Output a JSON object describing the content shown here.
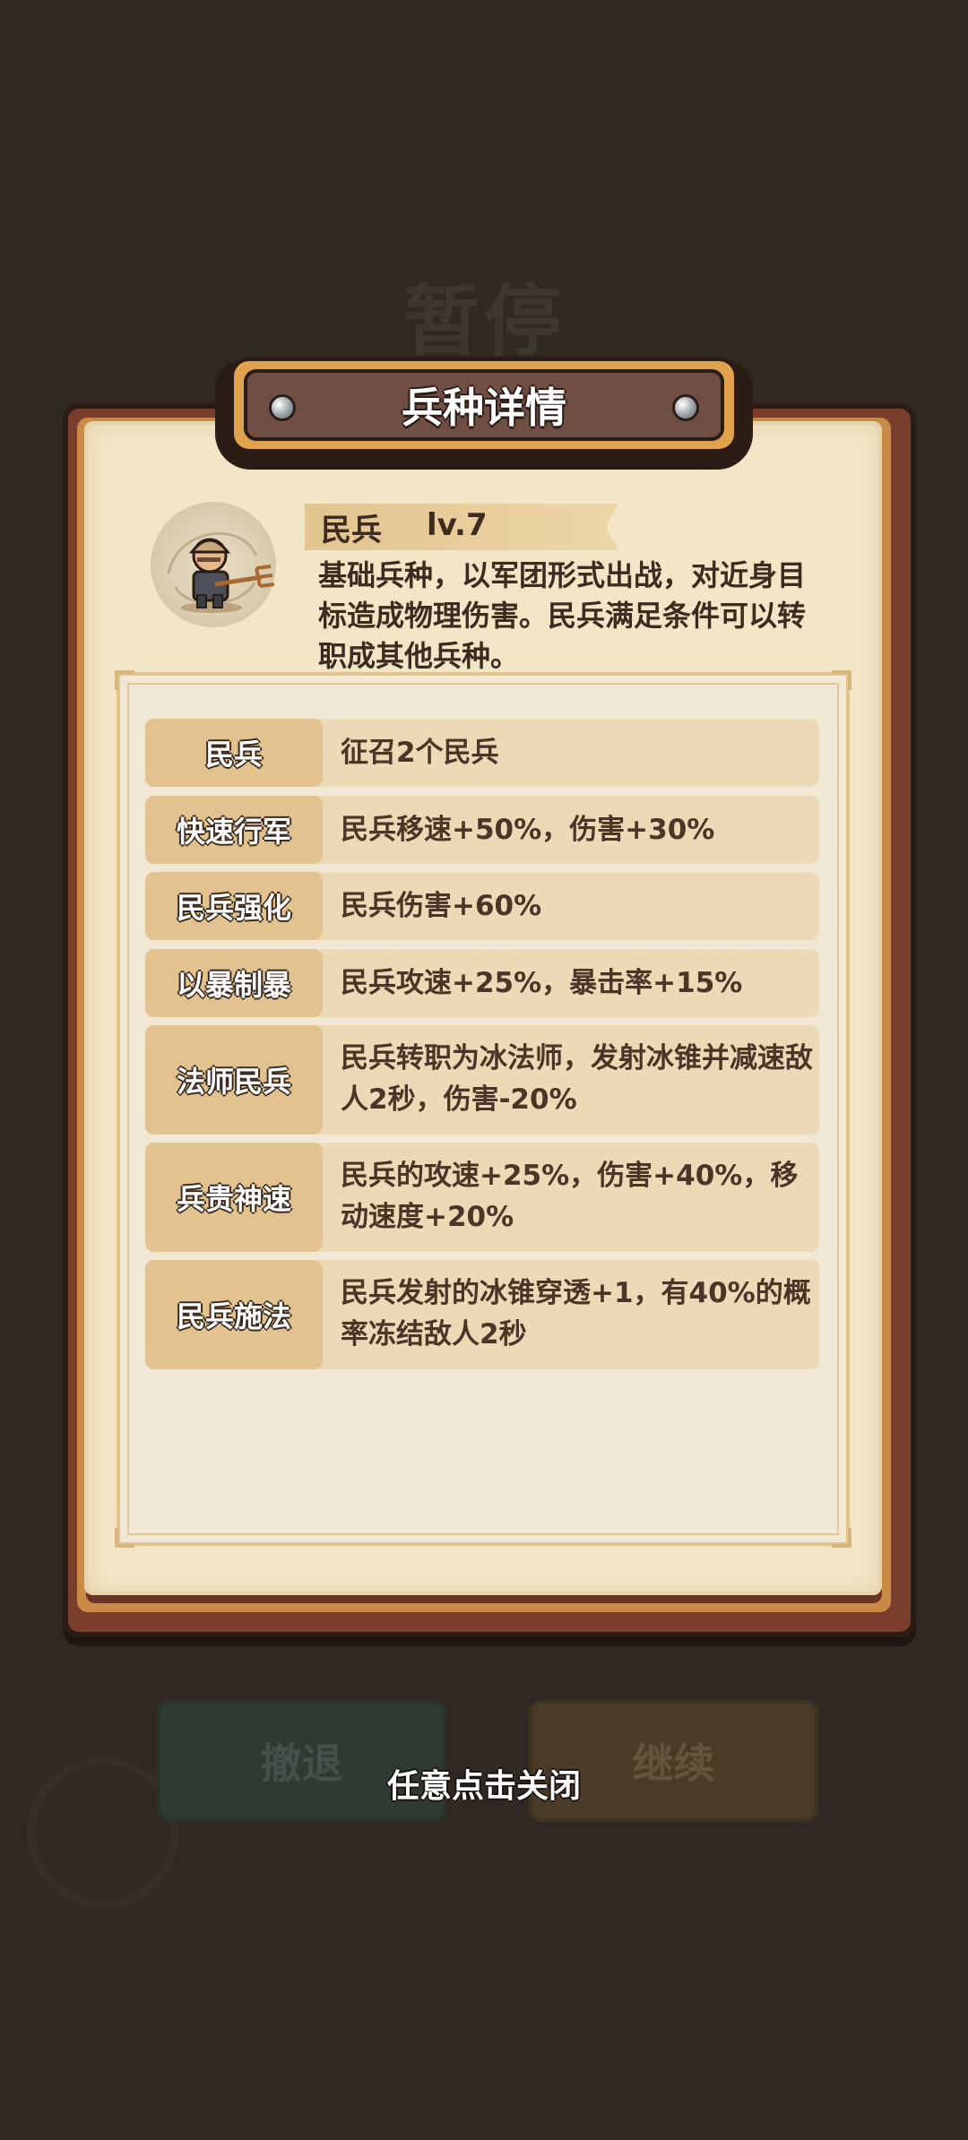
{
  "background": {
    "paused_title": "暂停",
    "retreat_label": "撤退",
    "continue_label": "继续"
  },
  "panel": {
    "title": "兵种详情"
  },
  "unit": {
    "name": "民兵",
    "level": "lv.7",
    "description": "基础兵种，以军团形式出战，对近身目标造成物理伤害。民兵满足条件可以转职成其他兵种。"
  },
  "talents": [
    {
      "name": "民兵",
      "desc": "征召2个民兵"
    },
    {
      "name": "快速行军",
      "desc": "民兵移速+50%，伤害+30%"
    },
    {
      "name": "民兵强化",
      "desc": "民兵伤害+60%"
    },
    {
      "name": "以暴制暴",
      "desc": "民兵攻速+25%，暴击率+15%"
    },
    {
      "name": "法师民兵",
      "desc": "民兵转职为冰法师，发射冰锥并减速敌人2秒，伤害-20%"
    },
    {
      "name": "兵贵神速",
      "desc": "民兵的攻速+25%，伤害+40%，移动速度+20%"
    },
    {
      "name": "民兵施法",
      "desc": "民兵发射的冰锥穿透+1，有40%的概率冻结敌人2秒"
    }
  ],
  "close_hint": "任意点击关闭",
  "colors": {
    "background": "#2f2823",
    "parchment": "#f3e6c7",
    "frame_brown": "#7a3f2c",
    "plaque_gold": "#e0a24d",
    "row_bg": "#ecd9b6",
    "row_name_bg": "#e2c28f",
    "text_dark": "#3e2a1e"
  },
  "icons": {
    "unit_avatar": "militia-pitchfork-icon",
    "rivets": "rivet-icon"
  }
}
